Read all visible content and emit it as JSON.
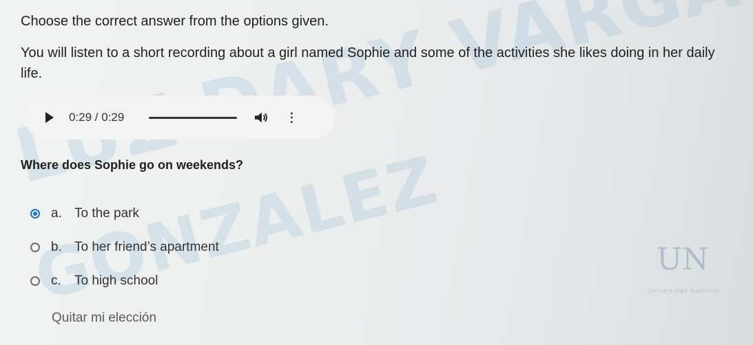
{
  "instruction": "Choose the correct answer from the options given.",
  "intro": "You will listen to a short recording about a girl named Sophie and some of the activities she likes doing in her daily life.",
  "audio": {
    "time": "0:29 / 0:29",
    "progress": 1.0
  },
  "question": "Where does Sophie go on weekends?",
  "options": [
    {
      "letter": "a.",
      "text": "To the park",
      "selected": true
    },
    {
      "letter": "b.",
      "text": "To her friend’s apartment",
      "selected": false
    },
    {
      "letter": "c.",
      "text": "To high school",
      "selected": false
    }
  ],
  "clear_choice": "Quitar mi elección",
  "watermark": {
    "line1": "LUZ DARY VARGAS",
    "line2": "GONZALEZ"
  },
  "logo": {
    "text": "UN",
    "subtitle": "Universidad Nacional"
  },
  "colors": {
    "radio_selected": "#1a73c8"
  }
}
